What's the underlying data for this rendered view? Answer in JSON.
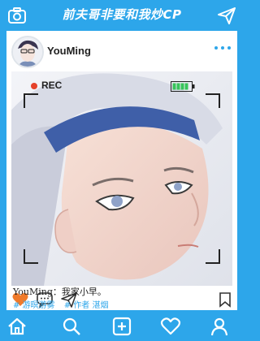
{
  "app": {
    "title": "前夫哥非要和我炒CP"
  },
  "post": {
    "username": "YouMing",
    "rec_label": "REC",
    "caption_user": "YouMing",
    "caption_text": "：我家小早。",
    "tags": [
      "# 游暝游雾",
      "# 作者 湛烟"
    ]
  },
  "colors": {
    "accent": "#2da6ea",
    "rec_red": "#e5422b",
    "heart": "#f07a2a",
    "battery_green": "#37c45a"
  },
  "icons": {
    "top": [
      "camera-icon",
      "send-icon"
    ],
    "post": [
      "more-icon",
      "heart-icon",
      "comment-icon",
      "share-icon",
      "bookmark-icon"
    ],
    "bottom": [
      "home-icon",
      "search-icon",
      "add-icon",
      "heart-icon",
      "profile-icon"
    ]
  }
}
